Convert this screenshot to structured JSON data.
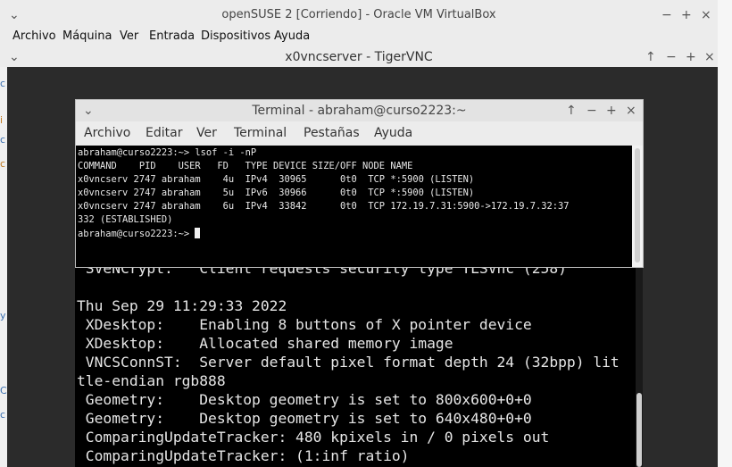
{
  "virtualbox": {
    "title": "openSUSE 2 [Corriendo] - Oracle VM VirtualBox",
    "menu": [
      "Archivo",
      "Máquina",
      "Ver",
      "Entrada",
      "Dispositivos",
      "Ayuda"
    ],
    "controls": {
      "minimize": "−",
      "maximize": "+",
      "close": "×"
    }
  },
  "vnc": {
    "title": "x0vncserver - TigerVNC",
    "controls": {
      "up": "↑",
      "minimize": "−",
      "maximize": "+",
      "close": "×"
    }
  },
  "terminal": {
    "title": "Terminal - abraham@curso2223:~",
    "menu": [
      "Archivo",
      "Editar",
      "Ver",
      "Terminal",
      "Pestañas",
      "Ayuda"
    ],
    "controls": {
      "up": "↑",
      "minimize": "−",
      "maximize": "+",
      "close": "×"
    },
    "lines": [
      "abraham@curso2223:~> lsof -i -nP",
      "COMMAND    PID    USER   FD   TYPE DEVICE SIZE/OFF NODE NAME",
      "x0vncserv 2747 abraham    4u  IPv4  30965      0t0  TCP *:5900 (LISTEN)",
      "x0vncserv 2747 abraham    5u  IPv6  30966      0t0  TCP *:5900 (LISTEN)",
      "x0vncserv 2747 abraham    6u  IPv4  33842      0t0  TCP 172.19.7.31:5900->172.19.7.32:37",
      "332 (ESTABLISHED)"
    ],
    "prompt": "abraham@curso2223:~> "
  },
  "background_terminal": {
    "lines": [
      " SVeNCrypt:   Client requests security type TLSVnc (258)",
      "",
      "Thu Sep 29 11:29:33 2022",
      " XDesktop:    Enabling 8 buttons of X pointer device",
      " XDesktop:    Allocated shared memory image",
      " VNCSConnST:  Server default pixel format depth 24 (32bpp) lit",
      "tle-endian rgb888",
      " Geometry:    Desktop geometry is set to 800x600+0+0",
      " Geometry:    Desktop geometry is set to 640x480+0+0",
      " ComparingUpdateTracker: 480 kpixels in / 0 pixels out",
      " ComparingUpdateTracker: (1:inf ratio)"
    ]
  },
  "desktop_left_glyphs": [
    "c",
    "i",
    "c",
    "c",
    "y",
    "C",
    "c"
  ]
}
